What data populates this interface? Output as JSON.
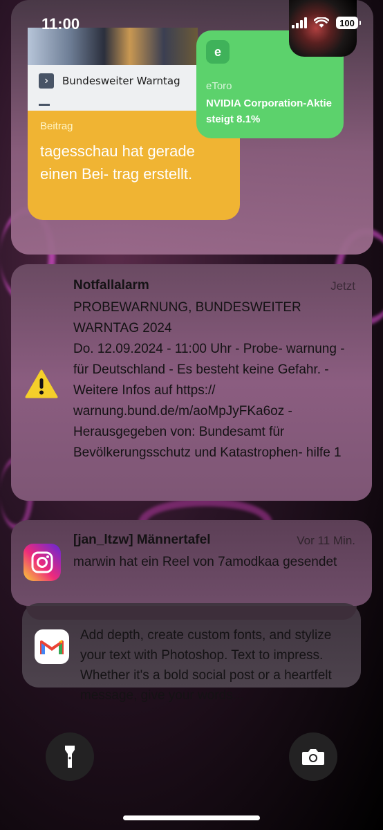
{
  "status_bar": {
    "time": "11:00",
    "battery": "100"
  },
  "widgets": {
    "news": {
      "label": "Bundesweiter Warntag"
    },
    "tagesschau": {
      "tag": "Beitrag",
      "text": "tagesschau hat gerade einen Bei- trag erstellt."
    },
    "etoro": {
      "app": "eToro",
      "text": "NVIDIA Corporation-Aktie steigt 8.1%"
    }
  },
  "notifications": [
    {
      "app": "Notfallalarm",
      "time": "Jetzt",
      "headline": "PROBEWARNUNG, BUNDESWEITER WARNTAG 2024",
      "body": "Do. 12.09.2024 - 11:00 Uhr - Probe- warnung - für Deutschland - Es besteht keine Gefahr. - Weitere Infos auf https:// warnung.bund.de/m/aoMpJyFKa6oz - Herausgegeben von: Bundesamt für Bevölkerungsschutz und Katastrophen- hilfe 1",
      "icon": "warning-icon"
    },
    {
      "app": "[jan_ltzw] Männertafel",
      "time": "Vor 11 Min.",
      "body": "marwin hat ein Reel von 7amodkaa gesendet",
      "icon": "instagram-icon"
    },
    {
      "body": "Add depth, create custom fonts, and stylize your text with Photoshop. Text to impress. Whether it's a bold social post or a heartfelt message, give your words...",
      "icon": "gmail-icon"
    }
  ],
  "controls": {
    "left": "flashlight-icon",
    "right": "camera-icon"
  },
  "colors": {
    "tagesschau_card": "#f0b433",
    "etoro_card": "#5cd26c",
    "warning": "#f5cf2a"
  }
}
